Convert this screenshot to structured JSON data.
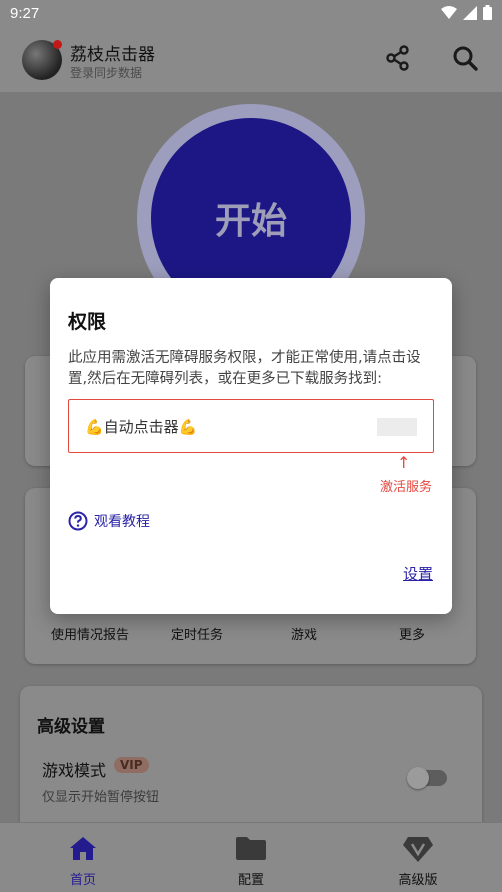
{
  "status_bar": {
    "time": "9:27",
    "icons": [
      "wifi-icon",
      "signal-icon",
      "battery-icon"
    ]
  },
  "app_bar": {
    "title": "荔枝点击器",
    "subtitle": "登录同步数据",
    "actions": [
      "share-icon",
      "search-icon"
    ]
  },
  "main": {
    "start_label": "开始"
  },
  "tools": [
    {
      "label": "使用情况报告"
    },
    {
      "label": "定时任务"
    },
    {
      "label": "游戏"
    },
    {
      "label": "更多"
    }
  ],
  "advanced": {
    "title": "高级设置",
    "game_mode": {
      "label": "游戏模式",
      "badge": "VIP",
      "description": "仅显示开始暂停按钮",
      "enabled": false
    }
  },
  "bottom_nav": [
    {
      "label": "首页",
      "icon": "home-icon",
      "active": true
    },
    {
      "label": "配置",
      "icon": "folder-icon",
      "active": false
    },
    {
      "label": "高级版",
      "icon": "vip-diamond-icon",
      "active": false
    }
  ],
  "dialog": {
    "title": "权限",
    "message": "此应用需激活无障碍服务权限，才能正常使用,请点击设置,然后在无障碍列表，或在更多已下载服务找到:",
    "service_name": "💪自动点击器💪",
    "arrow": "↑",
    "hint": "激活服务",
    "tutorial": "观看教程",
    "settings": "设置"
  },
  "colors": {
    "accent": "#231b8e",
    "warning": "#e5483f",
    "dim_overlay": "#7a7a7a"
  }
}
